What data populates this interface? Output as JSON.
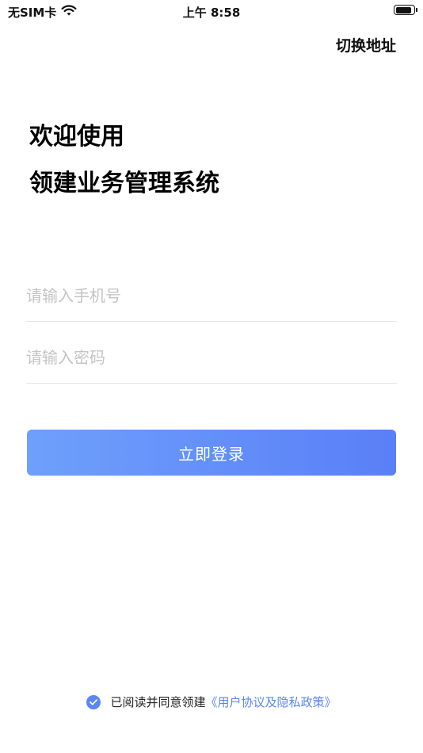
{
  "status_bar": {
    "carrier": "无SIM卡",
    "time": "上午 8:58",
    "battery_level": 0.9
  },
  "header": {
    "switch_address_label": "切换地址"
  },
  "welcome": {
    "line1": "欢迎使用",
    "line2": "领建业务管理系统"
  },
  "form": {
    "phone_placeholder": "请输入手机号",
    "phone_value": "",
    "password_placeholder": "请输入密码",
    "password_value": "",
    "login_label": "立即登录"
  },
  "agreement": {
    "checked": true,
    "text": "已阅读并同意领建",
    "link_text": "《用户协议及隐私政策》"
  },
  "colors": {
    "accent": "#5a86f6",
    "button_gradient_start": "#6ea0fb",
    "button_gradient_end": "#5a7ff7",
    "placeholder": "#c4c4c4",
    "divider": "#e6e6e6"
  },
  "icons": {
    "wifi": "wifi-icon",
    "battery": "battery-icon",
    "agree_check": "check-circle-icon"
  }
}
